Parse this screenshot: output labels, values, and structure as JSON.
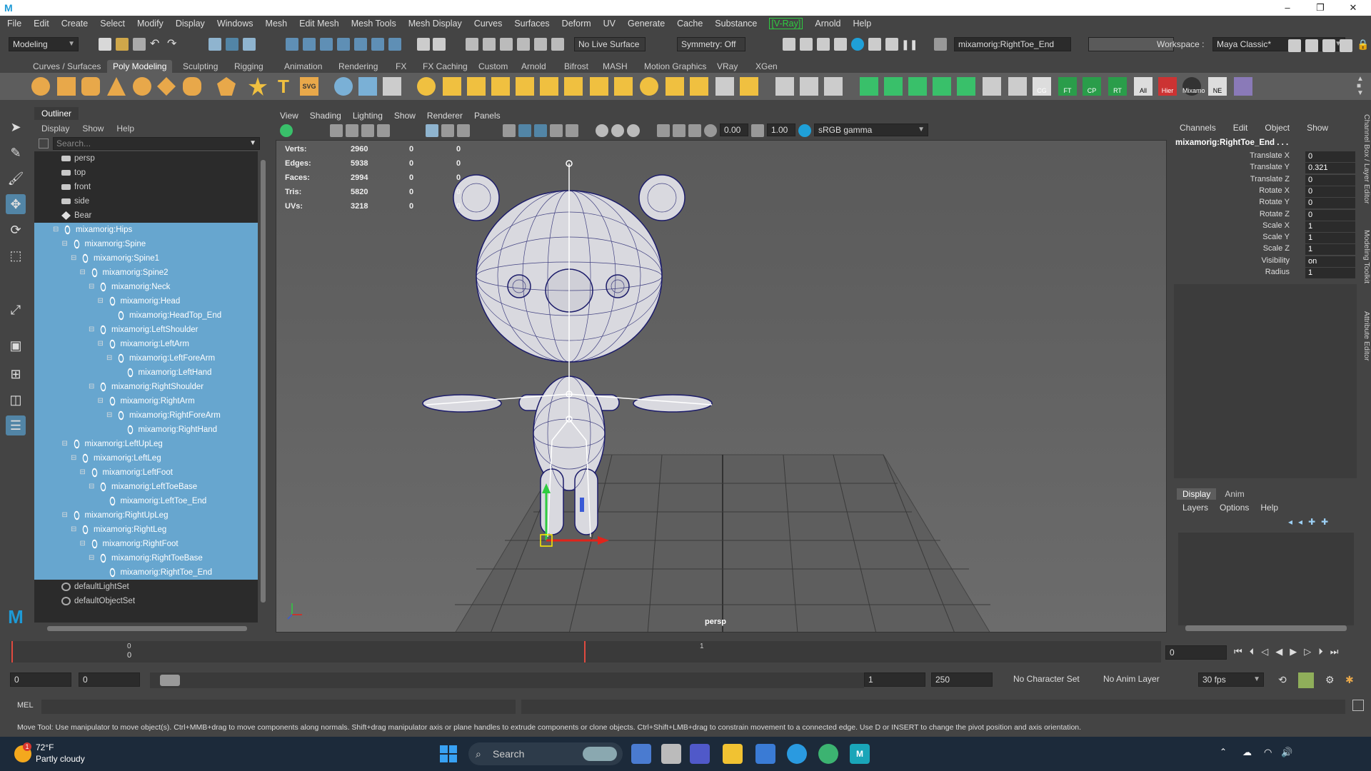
{
  "menubar": {
    "items": [
      "File",
      "Edit",
      "Create",
      "Select",
      "Modify",
      "Display",
      "Windows",
      "Mesh",
      "Edit Mesh",
      "Mesh Tools",
      "Mesh Display",
      "Curves",
      "Surfaces",
      "Deform",
      "UV",
      "Generate",
      "Cache",
      "Substance",
      "[V-Ray]",
      "Arnold",
      "Help"
    ]
  },
  "statusline": {
    "mode": "Modeling",
    "live_surface": "No Live Surface",
    "symmetry": "Symmetry: Off",
    "selected_name": "mixamorig:RightToe_End",
    "workspace_label": "Workspace :",
    "workspace_value": "Maya Classic*"
  },
  "shelf": {
    "tabs": [
      "Curves / Surfaces",
      "Poly Modeling",
      "Sculpting",
      "Rigging",
      "Animation",
      "Rendering",
      "FX",
      "FX Caching",
      "Custom",
      "Arnold",
      "Bifrost",
      "MASH",
      "Motion Graphics",
      "VRay",
      "XGen"
    ],
    "active_tab": "Poly Modeling",
    "labeled_icons": [
      "CG",
      "FT",
      "CP",
      "RT",
      "All",
      "Hier",
      "Mixamo",
      "NE"
    ]
  },
  "outliner": {
    "title": "Outliner",
    "menus": [
      "Display",
      "Show",
      "Help"
    ],
    "search_placeholder": "Search...",
    "cameras": [
      "persp",
      "top",
      "front",
      "side"
    ],
    "mesh": "Bear",
    "joints": [
      {
        "name": "mixamorig:Hips",
        "depth": 0
      },
      {
        "name": "mixamorig:Spine",
        "depth": 1
      },
      {
        "name": "mixamorig:Spine1",
        "depth": 2
      },
      {
        "name": "mixamorig:Spine2",
        "depth": 3
      },
      {
        "name": "mixamorig:Neck",
        "depth": 4
      },
      {
        "name": "mixamorig:Head",
        "depth": 5
      },
      {
        "name": "mixamorig:HeadTop_End",
        "depth": 6
      },
      {
        "name": "mixamorig:LeftShoulder",
        "depth": 4
      },
      {
        "name": "mixamorig:LeftArm",
        "depth": 5
      },
      {
        "name": "mixamorig:LeftForeArm",
        "depth": 6
      },
      {
        "name": "mixamorig:LeftHand",
        "depth": 7
      },
      {
        "name": "mixamorig:RightShoulder",
        "depth": 4
      },
      {
        "name": "mixamorig:RightArm",
        "depth": 5
      },
      {
        "name": "mixamorig:RightForeArm",
        "depth": 6
      },
      {
        "name": "mixamorig:RightHand",
        "depth": 7
      },
      {
        "name": "mixamorig:LeftUpLeg",
        "depth": 1
      },
      {
        "name": "mixamorig:LeftLeg",
        "depth": 2
      },
      {
        "name": "mixamorig:LeftFoot",
        "depth": 3
      },
      {
        "name": "mixamorig:LeftToeBase",
        "depth": 4
      },
      {
        "name": "mixamorig:LeftToe_End",
        "depth": 5
      },
      {
        "name": "mixamorig:RightUpLeg",
        "depth": 1
      },
      {
        "name": "mixamorig:RightLeg",
        "depth": 2
      },
      {
        "name": "mixamorig:RightFoot",
        "depth": 3
      },
      {
        "name": "mixamorig:RightToeBase",
        "depth": 4
      },
      {
        "name": "mixamorig:RightToe_End",
        "depth": 5
      }
    ],
    "sets": [
      "defaultLightSet",
      "defaultObjectSet"
    ]
  },
  "viewport": {
    "menus": [
      "View",
      "Shading",
      "Lighting",
      "Show",
      "Renderer",
      "Panels"
    ],
    "exposure": "0.00",
    "gamma": "1.00",
    "color_space": "sRGB gamma",
    "camera": "persp",
    "hud": [
      {
        "label": "Verts:",
        "v1": "2960",
        "v2": "0",
        "v3": "0"
      },
      {
        "label": "Edges:",
        "v1": "5938",
        "v2": "0",
        "v3": "0"
      },
      {
        "label": "Faces:",
        "v1": "2994",
        "v2": "0",
        "v3": "0"
      },
      {
        "label": "Tris:",
        "v1": "5820",
        "v2": "0",
        "v3": "0"
      },
      {
        "label": "UVs:",
        "v1": "3218",
        "v2": "0",
        "v3": "0"
      }
    ]
  },
  "channelbox": {
    "menus": [
      "Channels",
      "Edit",
      "Object",
      "Show"
    ],
    "object_name": "mixamorig:RightToe_End . . .",
    "channels": [
      {
        "name": "Translate X",
        "value": "0"
      },
      {
        "name": "Translate Y",
        "value": "0.321"
      },
      {
        "name": "Translate Z",
        "value": "0"
      },
      {
        "name": "Rotate X",
        "value": "0"
      },
      {
        "name": "Rotate Y",
        "value": "0"
      },
      {
        "name": "Rotate Z",
        "value": "0"
      },
      {
        "name": "Scale X",
        "value": "1"
      },
      {
        "name": "Scale Y",
        "value": "1"
      },
      {
        "name": "Scale Z",
        "value": "1"
      },
      {
        "name": "Visibility",
        "value": "on"
      },
      {
        "name": "Radius",
        "value": "1"
      }
    ],
    "side_tabs": [
      "Channel Box / Layer Editor",
      "Modeling Toolkit",
      "Attribute Editor"
    ]
  },
  "layer_editor": {
    "tabs": [
      "Display",
      "Anim"
    ],
    "menus": [
      "Layers",
      "Options",
      "Help"
    ]
  },
  "timeline": {
    "tick_0": "0",
    "tick_1": "1",
    "current_frame": "0",
    "current_label": "0"
  },
  "range": {
    "start": "0",
    "anim_start": "0",
    "range_start": "1",
    "range_end": "250",
    "character_set": "No Character Set",
    "anim_layer": "No Anim Layer",
    "fps": "30 fps"
  },
  "cmdline": {
    "label": "MEL"
  },
  "helpline": "Move Tool: Use manipulator to move object(s). Ctrl+MMB+drag to move components along normals. Shift+drag manipulator axis or plane handles to extrude components or clone objects. Ctrl+Shift+LMB+drag to constrain movement to a connected edge. Use D or INSERT to change the pivot position and axis orientation.",
  "taskbar": {
    "temp": "72°F",
    "weather": "Partly cloudy",
    "search": "Search",
    "badge": "1"
  }
}
